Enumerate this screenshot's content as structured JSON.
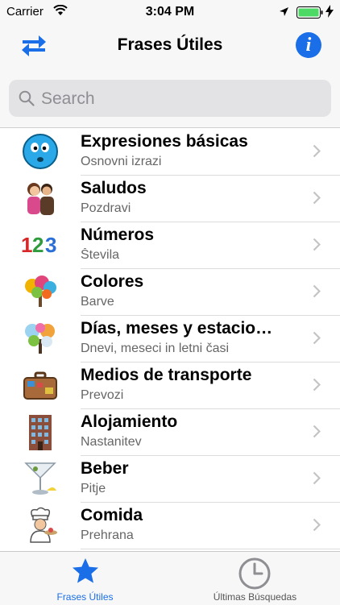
{
  "status_bar": {
    "carrier": "Carrier",
    "time": "3:04 PM"
  },
  "nav": {
    "title": "Frases Útiles"
  },
  "search": {
    "placeholder": "Search"
  },
  "categories": [
    {
      "title": "Expresiones básicas",
      "subtitle": "Osnovni izrazi",
      "icon": "smiley-face-icon"
    },
    {
      "title": "Saludos",
      "subtitle": "Pozdravi",
      "icon": "greeting-people-icon"
    },
    {
      "title": "Números",
      "subtitle": "Števila",
      "icon": "numbers-123-icon"
    },
    {
      "title": "Colores",
      "subtitle": "Barve",
      "icon": "colorful-tree-icon"
    },
    {
      "title": "Días, meses y estacio…",
      "subtitle": "Dnevi, meseci in letni časi",
      "icon": "seasons-tree-icon"
    },
    {
      "title": "Medios de transporte",
      "subtitle": "Prevozi",
      "icon": "suitcase-icon"
    },
    {
      "title": "Alojamiento",
      "subtitle": "Nastanitev",
      "icon": "hotel-building-icon"
    },
    {
      "title": "Beber",
      "subtitle": "Pitje",
      "icon": "cocktail-glass-icon"
    },
    {
      "title": "Comida",
      "subtitle": "Prehrana",
      "icon": "chef-icon"
    }
  ],
  "tabs": [
    {
      "label": "Frases Útiles",
      "icon": "star-icon",
      "active": true
    },
    {
      "label": "Últimas Búsquedas",
      "icon": "clock-icon",
      "active": false
    }
  ],
  "colors": {
    "accent": "#1a6fe8",
    "bar_background": "#f7f7f7",
    "battery": "#4cd964"
  }
}
